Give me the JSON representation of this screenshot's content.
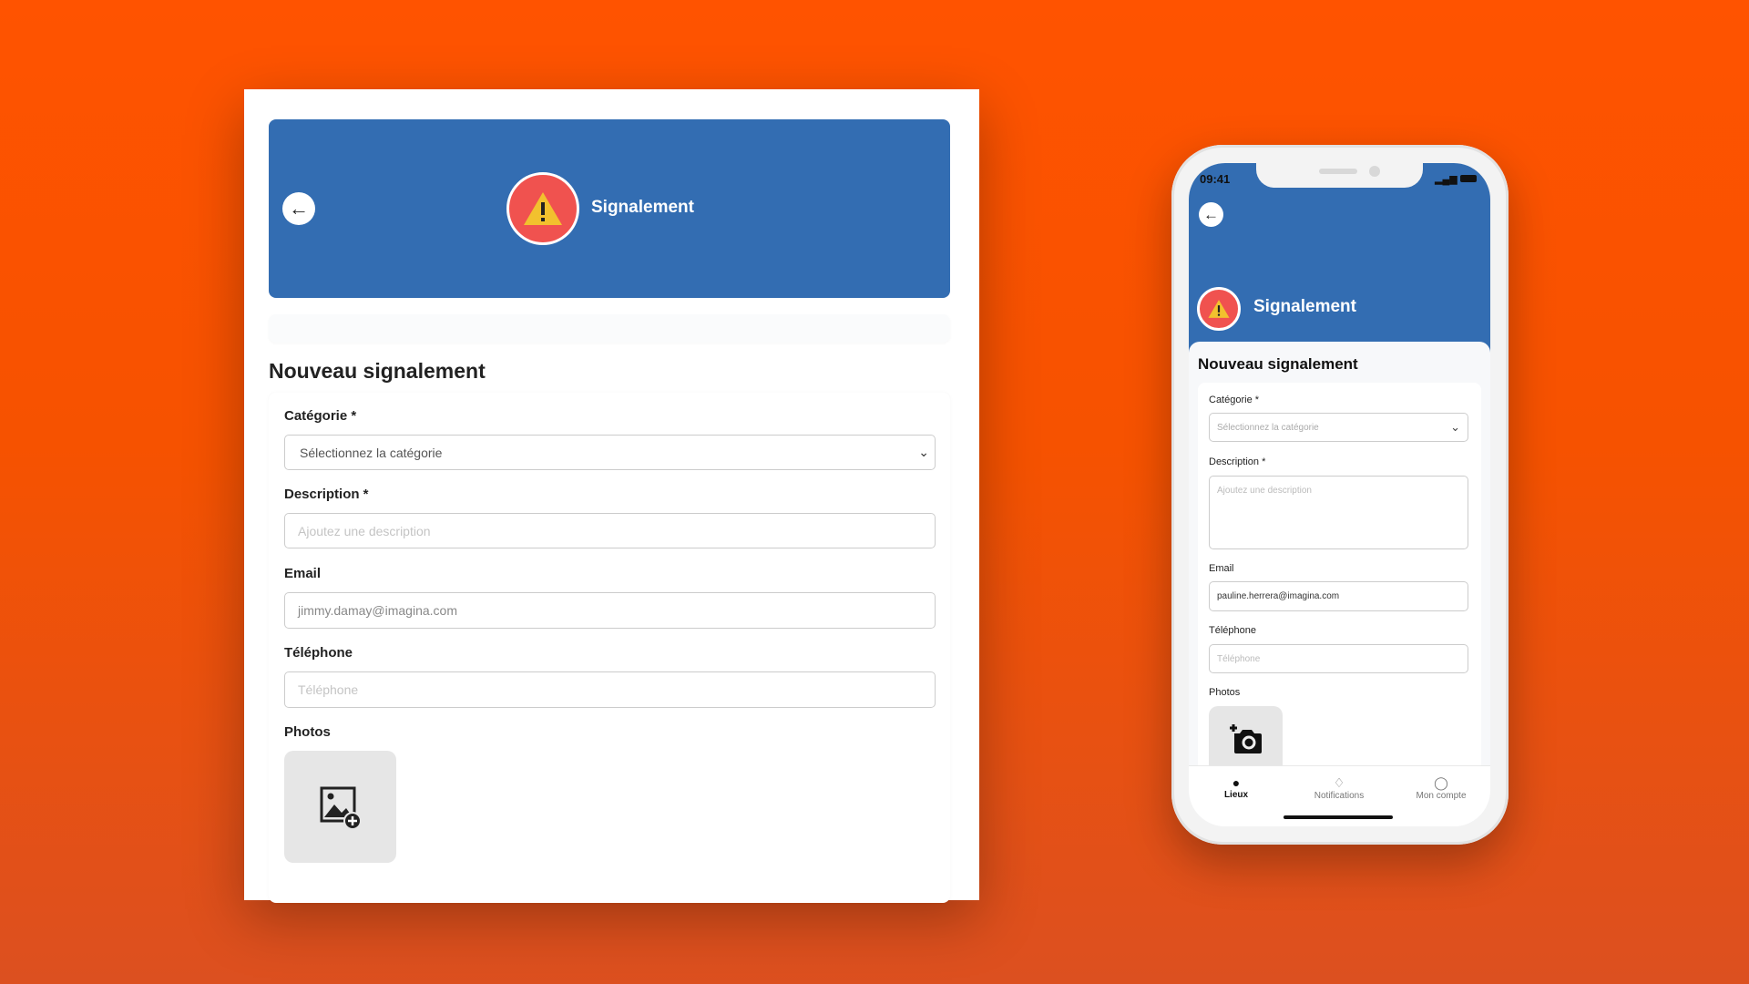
{
  "desktop": {
    "title": "Signalement",
    "heading": "Nouveau signalement",
    "category_label": "Catégorie *",
    "category_placeholder": "Sélectionnez la catégorie",
    "description_label": "Description *",
    "description_placeholder": "Ajoutez une description",
    "email_label": "Email",
    "email_value": "jimmy.damay@imagina.com",
    "phone_label": "Téléphone",
    "phone_placeholder": "Téléphone",
    "photos_label": "Photos"
  },
  "mobile": {
    "status_time": "09:41",
    "title": "Signalement",
    "heading": "Nouveau signalement",
    "category_label": "Catégorie *",
    "category_placeholder": "Sélectionnez la catégorie",
    "description_label": "Description *",
    "description_placeholder": "Ajoutez une description",
    "email_label": "Email",
    "email_value": "pauline.herrera@imagina.com",
    "phone_label": "Téléphone",
    "phone_placeholder": "Téléphone",
    "photos_label": "Photos",
    "tabs": [
      {
        "label": "Lieux",
        "icon": "map-pin-icon",
        "active": true
      },
      {
        "label": "Notifications",
        "icon": "bell-icon"
      },
      {
        "label": "Mon compte",
        "icon": "user-icon"
      }
    ]
  },
  "colors": {
    "brand_blue": "#336db2",
    "alert_red": "#f0524f",
    "warning_yellow": "#f2c12e",
    "background": "#ff5300"
  }
}
